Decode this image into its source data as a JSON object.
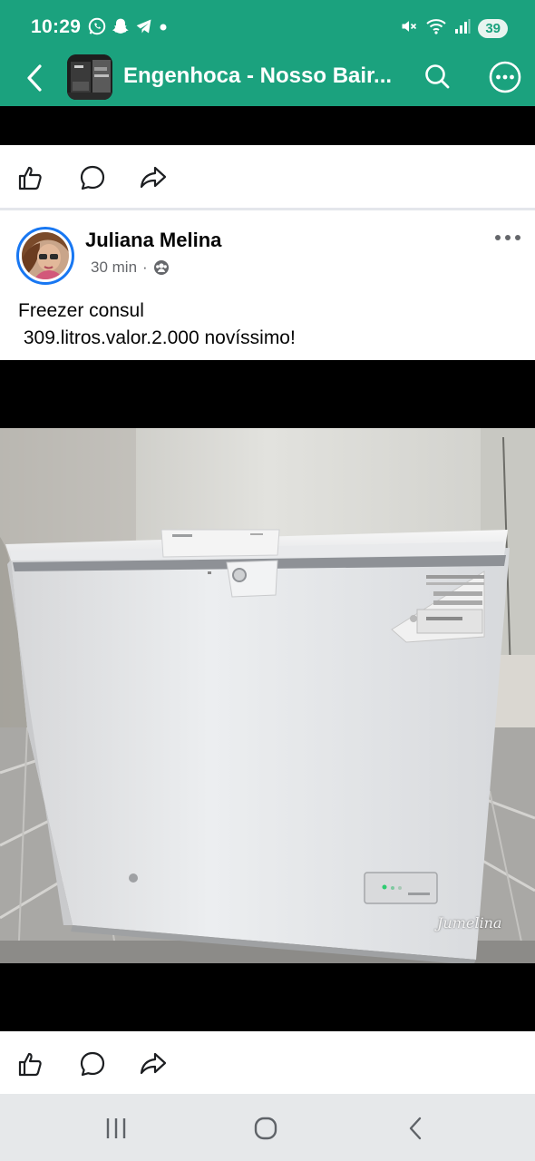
{
  "status_bar": {
    "time": "10:29",
    "battery": "39",
    "notification_icons": [
      "whatsapp-icon",
      "snapchat-icon",
      "telegram-icon",
      "dot-icon"
    ],
    "system_icons": [
      "mute-icon",
      "wifi-icon",
      "signal-icon"
    ]
  },
  "app_bar": {
    "title": "Engenhoca - Nosso Bair...",
    "back_icon": "chevron-left-icon",
    "search_icon": "search-icon",
    "more_icon": "more-horizontal-circle-icon"
  },
  "reaction_bar": {
    "icons": [
      "like-icon",
      "comment-icon",
      "share-icon"
    ]
  },
  "post": {
    "author": "Juliana Melina",
    "time": "30 min",
    "separator": "·",
    "audience_icon": "group-audience-icon",
    "text_line1": "Freezer consul",
    "text_line2": " 309.litros.valor.2.000 novíssimo!",
    "photo_watermark": "Jumelina"
  },
  "colors": {
    "app_bar": "#1ba27e",
    "avatar_ring": "#1877f2",
    "meta_text": "#65676b",
    "nav_bar": "#e6e8ea"
  },
  "nav_bar": {
    "icons": [
      "recent-apps-icon",
      "home-icon",
      "back-icon"
    ]
  }
}
